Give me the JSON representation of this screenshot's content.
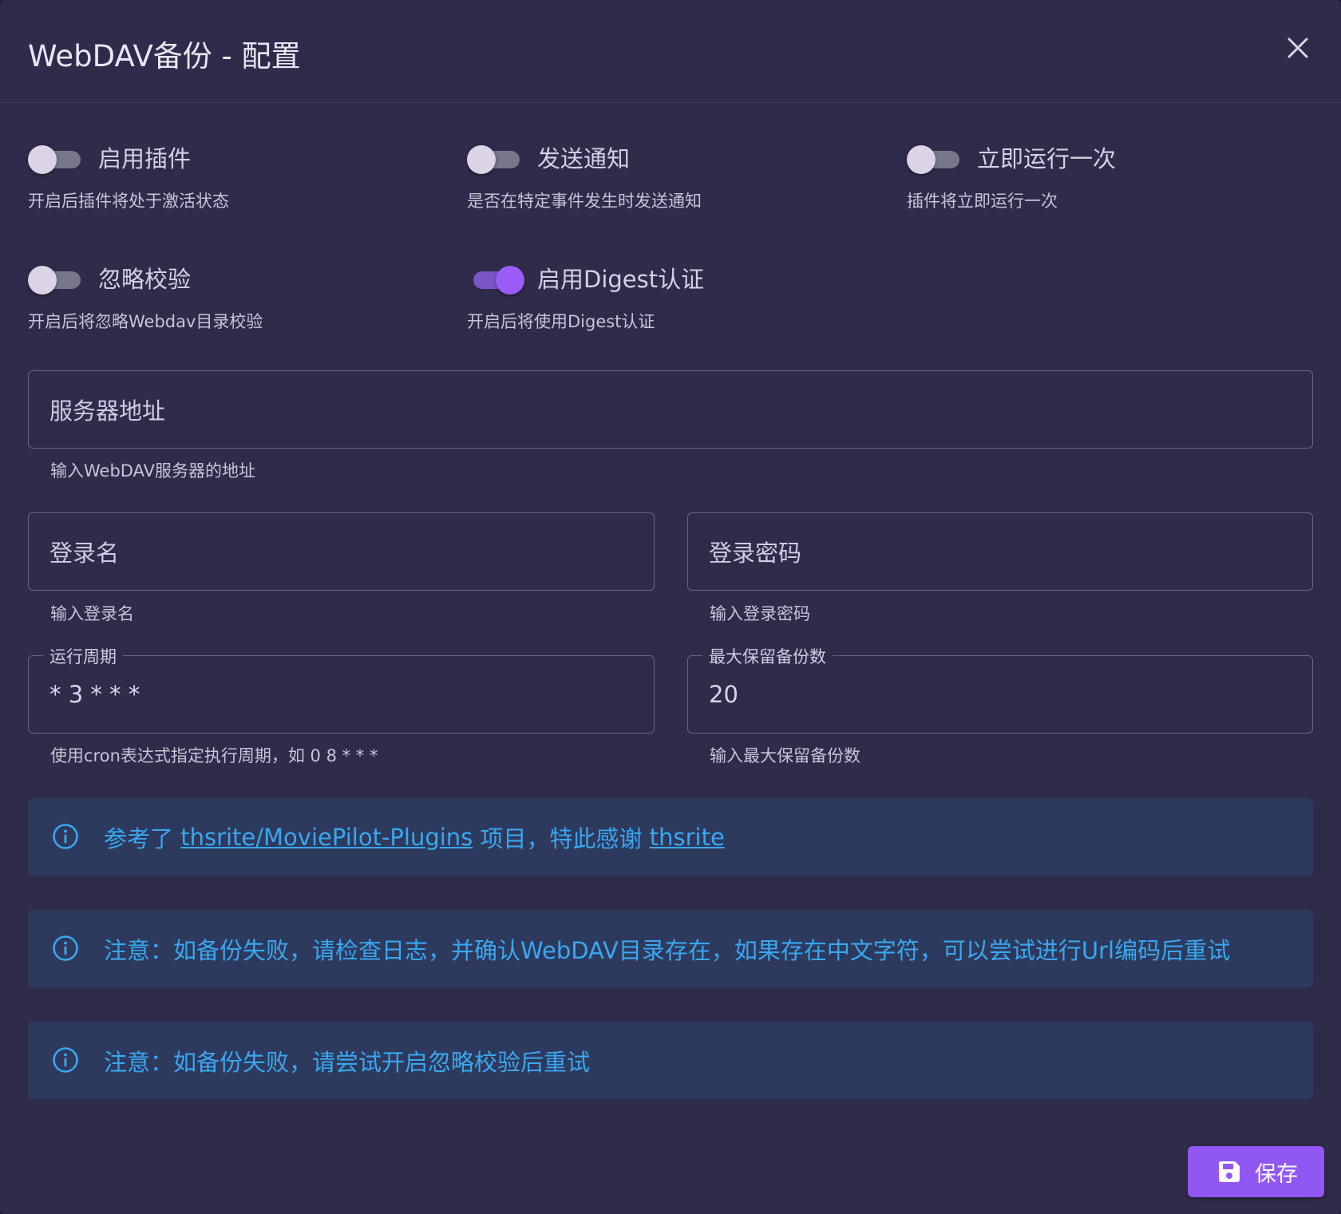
{
  "dialog": {
    "title": "WebDAV备份 - 配置"
  },
  "switches": [
    {
      "label": "启用插件",
      "hint": "开启后插件将处于激活状态",
      "on": false
    },
    {
      "label": "发送通知",
      "hint": "是否在特定事件发生时发送通知",
      "on": false
    },
    {
      "label": "立即运行一次",
      "hint": "插件将立即运行一次",
      "on": false
    },
    {
      "label": "忽略校验",
      "hint": "开启后将忽略Webdav目录校验",
      "on": false
    },
    {
      "label": "启用Digest认证",
      "hint": "开启后将使用Digest认证",
      "on": true
    }
  ],
  "fields": {
    "server": {
      "placeholder": "服务器地址",
      "hint": "输入WebDAV服务器的地址"
    },
    "username": {
      "placeholder": "登录名",
      "hint": "输入登录名"
    },
    "password": {
      "placeholder": "登录密码",
      "hint": "输入登录密码"
    },
    "cron": {
      "label": "运行周期",
      "value": "* 3 * * *",
      "hint": "使用cron表达式指定执行周期，如 0 8 * * *"
    },
    "max_backups": {
      "label": "最大保留备份数",
      "value": "20",
      "hint": "输入最大保留备份数"
    }
  },
  "alerts": {
    "credit": {
      "prefix": "参考了 ",
      "repo_link": "thsrite/MoviePilot-Plugins",
      "middle": " 项目，特此感谢 ",
      "author_link": "thsrite"
    },
    "notice1": "注意：如备份失败，请检查日志，并确认WebDAV目录存在，如果存在中文字符，可以尝试进行Url编码后重试",
    "notice2": "注意：如备份失败，请尝试开启忽略校验后重试"
  },
  "actions": {
    "save_label": "保存"
  },
  "colors": {
    "accent": "#9157f3",
    "info": "#39a7ef",
    "background": "#2f2b4a"
  }
}
